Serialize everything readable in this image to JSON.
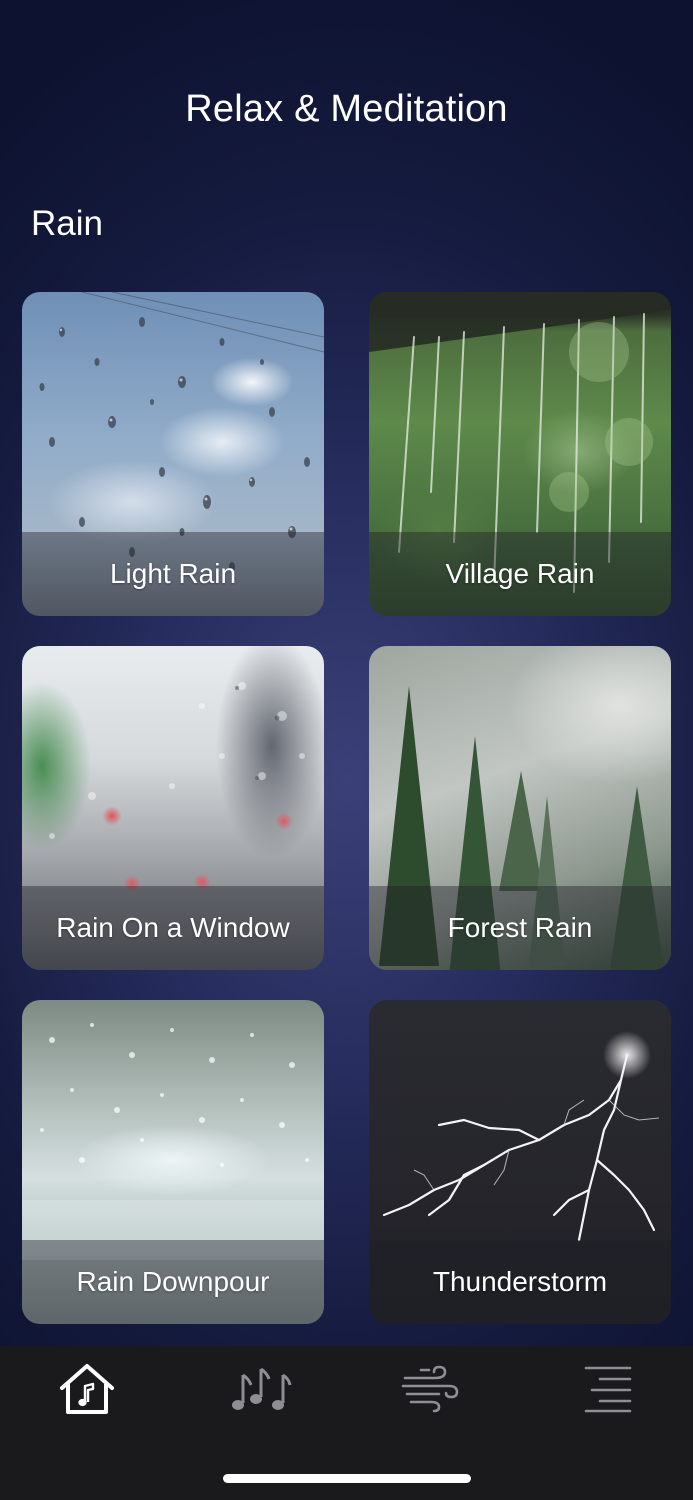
{
  "header": {
    "title": "Relax & Meditation"
  },
  "section": {
    "title": "Rain"
  },
  "cards": [
    {
      "label": "Light Rain",
      "image": "raindrops-on-glass-sky"
    },
    {
      "label": "Village Rain",
      "image": "rain-falling-from-roof-greenery"
    },
    {
      "label": "Rain On a Window",
      "image": "rainy-window-city-traffic"
    },
    {
      "label": "Forest Rain",
      "image": "misty-pine-forest"
    },
    {
      "label": "Rain Downpour",
      "image": "heavy-rain-splashing"
    },
    {
      "label": "Thunderstorm",
      "image": "lightning-bolt"
    }
  ],
  "tab_bar": {
    "tabs": [
      {
        "name": "home",
        "icon": "home-music-icon",
        "active": true
      },
      {
        "name": "music",
        "icon": "music-notes-icon",
        "active": false
      },
      {
        "name": "ambient",
        "icon": "wind-icon",
        "active": false
      },
      {
        "name": "menu",
        "icon": "menu-lines-icon",
        "active": false
      }
    ]
  },
  "colors": {
    "background_top": "#0d1230",
    "background_center": "#3b4178",
    "tab_bar": "#1a1a1c",
    "active_icon": "#ffffff",
    "inactive_icon": "#8e8e93"
  }
}
